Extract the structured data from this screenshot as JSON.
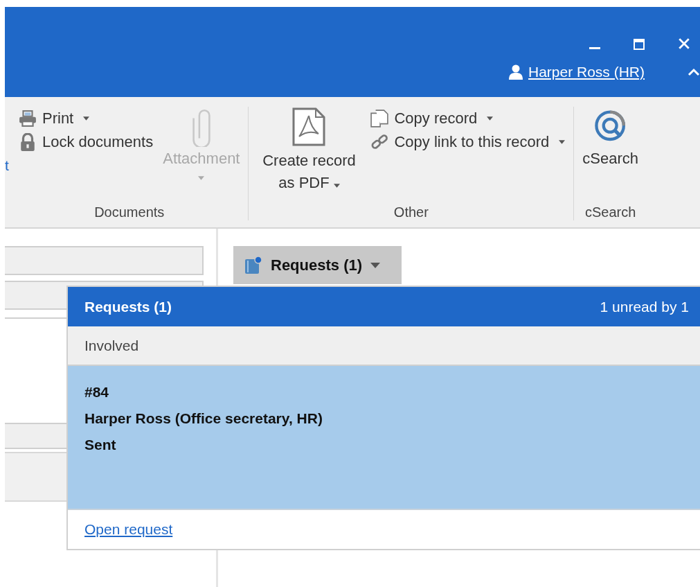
{
  "user": {
    "name": "Harper Ross (HR)"
  },
  "ribbon": {
    "cut_label": "t",
    "groups": [
      {
        "label": "Documents",
        "small": [
          {
            "label": "Print",
            "dropdown": true,
            "disabled": false
          },
          {
            "label": "Lock documents",
            "dropdown": false,
            "disabled": false
          }
        ],
        "large": [
          {
            "label": "Attachment",
            "dropdown": true,
            "disabled": true
          }
        ]
      },
      {
        "label": "Other",
        "large": [
          {
            "label": "Create record as PDF",
            "dropdown": true,
            "disabled": false
          }
        ],
        "small": [
          {
            "label": "Copy record",
            "dropdown": true,
            "disabled": false
          },
          {
            "label": "Copy link to this record",
            "dropdown": true,
            "disabled": false
          }
        ]
      },
      {
        "label": "cSearch",
        "large": [
          {
            "label": "cSearch",
            "dropdown": false,
            "disabled": false
          }
        ]
      }
    ]
  },
  "requests_tab": {
    "label": "Requests (1)",
    "unread": true
  },
  "popup": {
    "title": "Requests (1)",
    "summary": "1 unread by 1",
    "section": "Involved",
    "items": [
      {
        "lines": [
          "#84",
          "Harper Ross (Office secretary, HR)",
          "Sent"
        ],
        "selected": true
      }
    ],
    "link": "Open request"
  }
}
